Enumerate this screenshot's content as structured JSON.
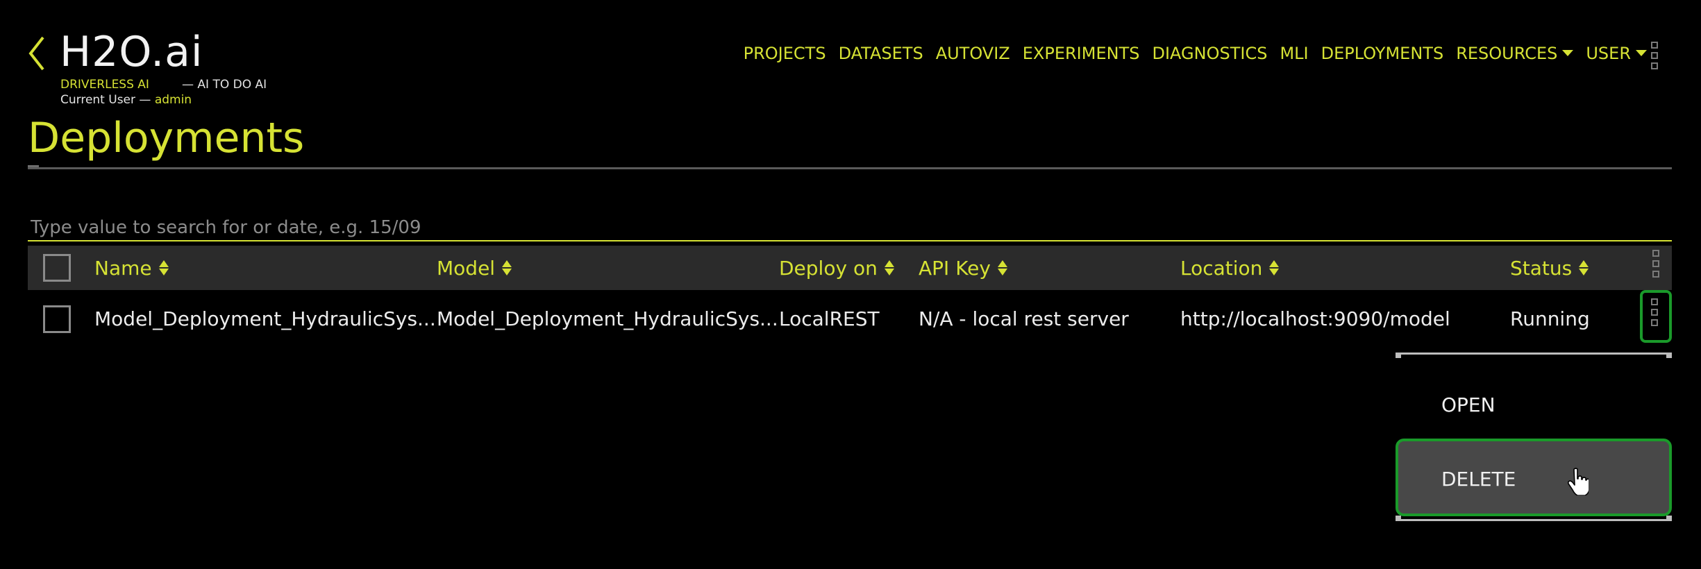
{
  "brand": {
    "name": "H2O.ai",
    "product": "DRIVERLESS AI",
    "tagline": "— AI TO DO AI",
    "current_user_label": "Current User —",
    "current_user": "admin",
    "accent_color": "#d6e234"
  },
  "nav": {
    "items": [
      {
        "label": "PROJECTS"
      },
      {
        "label": "DATASETS"
      },
      {
        "label": "AUTOVIZ"
      },
      {
        "label": "EXPERIMENTS"
      },
      {
        "label": "DIAGNOSTICS"
      },
      {
        "label": "MLI"
      },
      {
        "label": "DEPLOYMENTS"
      },
      {
        "label": "RESOURCES",
        "dropdown": true
      },
      {
        "label": "USER",
        "dropdown": true
      }
    ]
  },
  "page": {
    "title": "Deployments"
  },
  "search": {
    "placeholder": "Type value to search for or date, e.g. 15/09",
    "value": ""
  },
  "table": {
    "columns": [
      "Name",
      "Model",
      "Deploy on",
      "API Key",
      "Location",
      "Status"
    ],
    "rows": [
      {
        "name": "Model_Deployment_HydraulicSys...",
        "model": "Model_Deployment_HydraulicSys...",
        "deploy_on": "LocalREST",
        "api_key": "N/A - local rest server",
        "location": "http://localhost:9090/model",
        "status": "Running",
        "selected": false
      }
    ]
  },
  "context_menu": {
    "items": [
      "OPEN",
      "DELETE"
    ],
    "highlighted": "DELETE",
    "highlight_color": "#1a9a2a"
  },
  "icons": {
    "back": "chevron-left-icon",
    "menu": "grid-menu-icon",
    "sort": "sort-icon",
    "cursor": "hand-pointer-icon"
  }
}
